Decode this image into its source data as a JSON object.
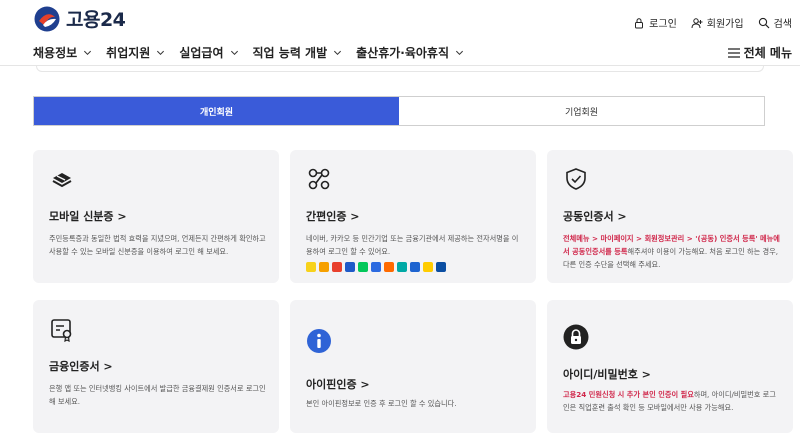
{
  "header": {
    "logo_text": "고용24",
    "util": {
      "login": "로그인",
      "signup": "회원가입",
      "search": "검색"
    }
  },
  "gnb": {
    "items": [
      "채용정보",
      "취업지원",
      "실업급여",
      "직업 능력 개발",
      "출산휴가·육아휴직"
    ],
    "all_menu": "전체 메뉴"
  },
  "tabs": {
    "personal": "개인회원",
    "company": "기업회원"
  },
  "cards": [
    {
      "title": "모바일 신분증 >",
      "desc": "주민등록증과 동일한 법적 효력을 지녔으며, 언제든지 간편하게 확인하고 사용할 수 있는 모바일 신분증을 이용하여 로그인 해 보세요."
    },
    {
      "title": "간편인증 >",
      "desc": "네이버, 카카오 등 민간기업 또는 금융기관에서 제공하는 전자서명을 이용하여 로그인 할 수 있어요."
    },
    {
      "title": "공동인증서 >",
      "desc_red": "전체메뉴 > 마이페이지 > 회원정보관리 > '(공동) 인증서 등록' 메뉴에서 공동인증서를 등록",
      "desc_rest": "해주셔야 이용이 가능해요. 처음 로그인 하는 경우, 다른 인증 수단을 선택해 주세요."
    },
    {
      "title": "금융인증서 >",
      "desc": "은행 앱 또는 인터넷뱅킹 사이트에서 발급한 금융결제원 인증서로 로그인 해 보세요."
    },
    {
      "title": "아이핀인증 >",
      "desc": "본인 아이핀정보로 인증 후 로그인 할 수 있습니다."
    },
    {
      "title": "아이디/비밀번호 >",
      "desc_red": "고용24 민원신청 시 추가 본인 인증이 필요",
      "desc_rest": "하며, 아이디/비밀번호 로그인은 직업훈련 출석 확인 등 모바일에서만 사용 가능해요."
    }
  ],
  "badge_colors": [
    "#f7d21b",
    "#f6a000",
    "#e8402d",
    "#1f5ac8",
    "#03c75a",
    "#2c6ae0",
    "#ff6a00",
    "#00a9a5",
    "#1e64d0",
    "#ffcc00",
    "#0b4ea2"
  ],
  "colors": {
    "accent": "#3a5bd9",
    "red_text": "#d0264a",
    "card_bg": "#f3f3f5"
  }
}
